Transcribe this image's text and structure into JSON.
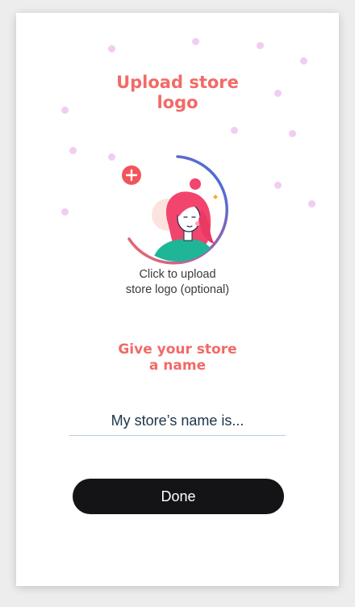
{
  "upload": {
    "title_line1": "Upload store",
    "title_line2": "logo",
    "caption_line1": "Click to upload",
    "caption_line2": "store logo (optional)"
  },
  "store_name": {
    "title_line1": "Give your store",
    "title_line2": "a name",
    "placeholder": "My store’s name is...",
    "value": ""
  },
  "actions": {
    "done_label": "Done"
  },
  "theme": {
    "accent": "#f26a67",
    "decor_dot": "#f1cdf1",
    "button_bg": "#141416",
    "text_dark": "#1d3349"
  },
  "icons": {
    "add": "plus-circle-icon",
    "avatar": "woman-illustration"
  }
}
